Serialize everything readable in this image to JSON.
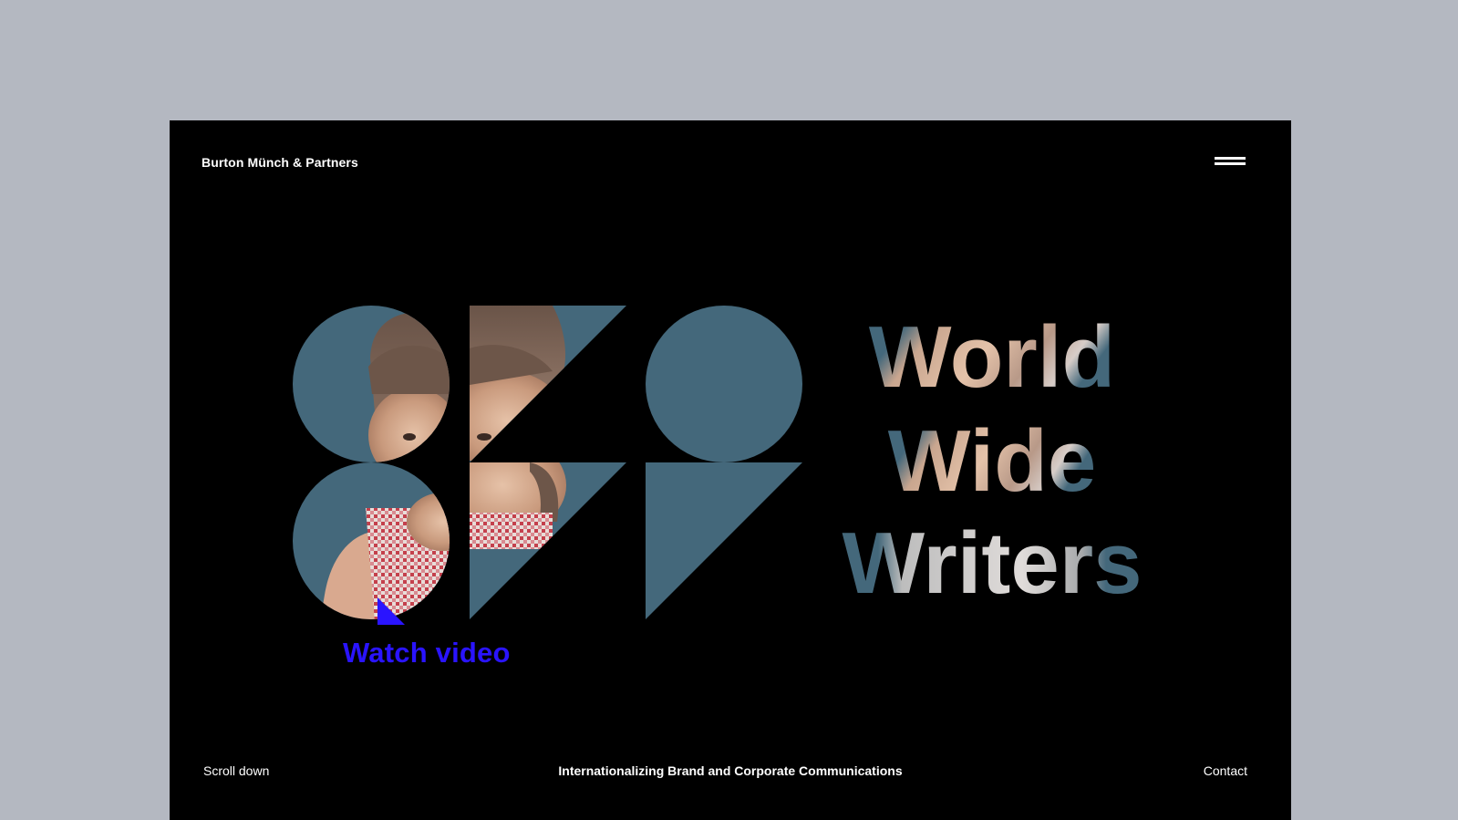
{
  "header": {
    "brand": "Burton Münch & Partners",
    "menu_icon": "hamburger-menu-icon"
  },
  "hero": {
    "headline_lines": [
      "World",
      "Wide",
      "Writers"
    ],
    "watch_video_label": "Watch video",
    "watch_video_icon": "triangle-play-icon"
  },
  "footer": {
    "scroll_label": "Scroll down",
    "tagline": "Internationalizing Brand and Corporate Communications",
    "contact_label": "Contact"
  },
  "colors": {
    "page_background": "#b4b8c1",
    "frame_background": "#000000",
    "shape_teal": "#44687b",
    "accent_blue": "#2a14ff",
    "text_white": "#ffffff"
  }
}
